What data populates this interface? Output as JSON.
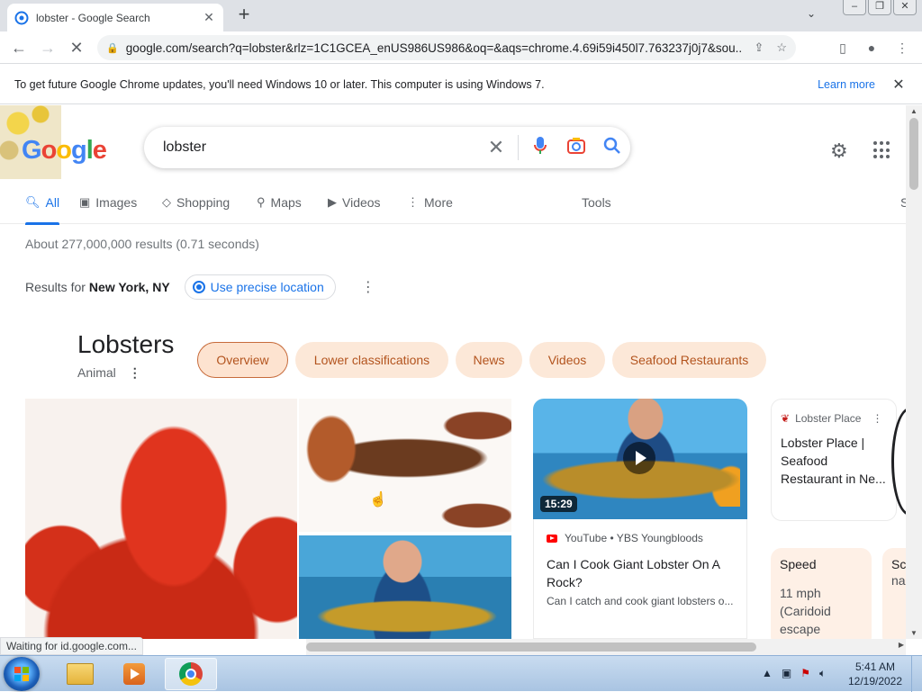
{
  "browser": {
    "tab_title": "lobster - Google Search",
    "url": "google.com/search?q=lobster&rlz=1C1GCEA_enUS986US986&oq=&aqs=chrome.4.69i59i450l7.763237j0j7&sou...",
    "infobar_message": "To get future Google Chrome updates, you'll need Windows 10 or later. This computer is using Windows 7.",
    "infobar_link": "Learn more",
    "status_text": "Waiting for id.google.com..."
  },
  "google": {
    "logo_letters": [
      "G",
      "o",
      "o",
      "g",
      "l",
      "e"
    ],
    "query": "lobster",
    "tabs": [
      "All",
      "Images",
      "Shopping",
      "Maps",
      "Videos",
      "More"
    ],
    "tools": "Tools",
    "partial_right": "S",
    "stats": "About 277,000,000 results (0.71 seconds)",
    "results_for_prefix": "Results for",
    "location": "New York, NY",
    "precise_location": "Use precise location"
  },
  "knowledge_panel": {
    "title": "Lobsters",
    "subtitle": "Animal",
    "chips": [
      "Overview",
      "Lower classifications",
      "News",
      "Videos",
      "Seafood Restaurants"
    ],
    "video": {
      "duration": "15:29",
      "source": "YouTube • YBS Youngbloods",
      "title": "Can I Cook Giant Lobster On A Rock?",
      "description": "Can I catch and cook giant lobsters o..."
    },
    "place_card": {
      "source": "Lobster Place",
      "title": "Lobster Place | Seafood Restaurant in Ne..."
    },
    "facts": [
      {
        "label": "Speed",
        "value": "11 mph (Caridoid escape"
      },
      {
        "label": "Sc",
        "value": "na"
      }
    ]
  },
  "taskbar": {
    "time": "5:41 AM",
    "date": "12/19/2022"
  },
  "colors": {
    "accent": "#1a73e8",
    "chip_bg": "#fce8d8",
    "chip_text": "#b3541e"
  }
}
